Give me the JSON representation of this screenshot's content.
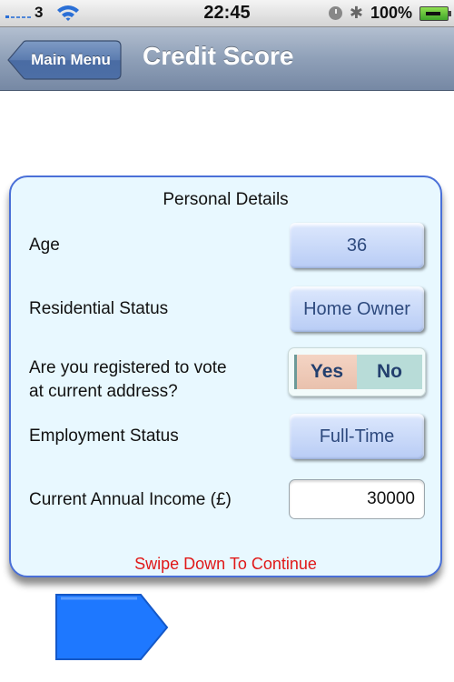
{
  "status_bar": {
    "carrier": "3",
    "time": "22:45",
    "battery_percent": "100%",
    "icons": [
      "signal-icon",
      "wifi-icon",
      "clock-icon",
      "bluetooth-icon",
      "battery-charging-icon"
    ]
  },
  "nav": {
    "back_label": "Main Menu",
    "title": "Credit Score"
  },
  "card": {
    "title": "Personal Details",
    "age": {
      "label": "Age",
      "value": "36"
    },
    "residential": {
      "label": "Residential Status",
      "value": "Home Owner"
    },
    "vote": {
      "label_line1": "Are you registered to vote",
      "label_line2": "at current address?",
      "yes": "Yes",
      "no": "No",
      "selected": "Yes"
    },
    "employment": {
      "label": "Employment Status",
      "value": "Full-Time"
    },
    "income": {
      "label": "Current Annual Income (£)",
      "value": "30000"
    },
    "hint": "Swipe Down To Continue"
  },
  "colors": {
    "card_border": "#4a70d8",
    "card_bg": "#e8f8ff",
    "hint": "#e01818",
    "next_arrow": "#1e78ff"
  }
}
